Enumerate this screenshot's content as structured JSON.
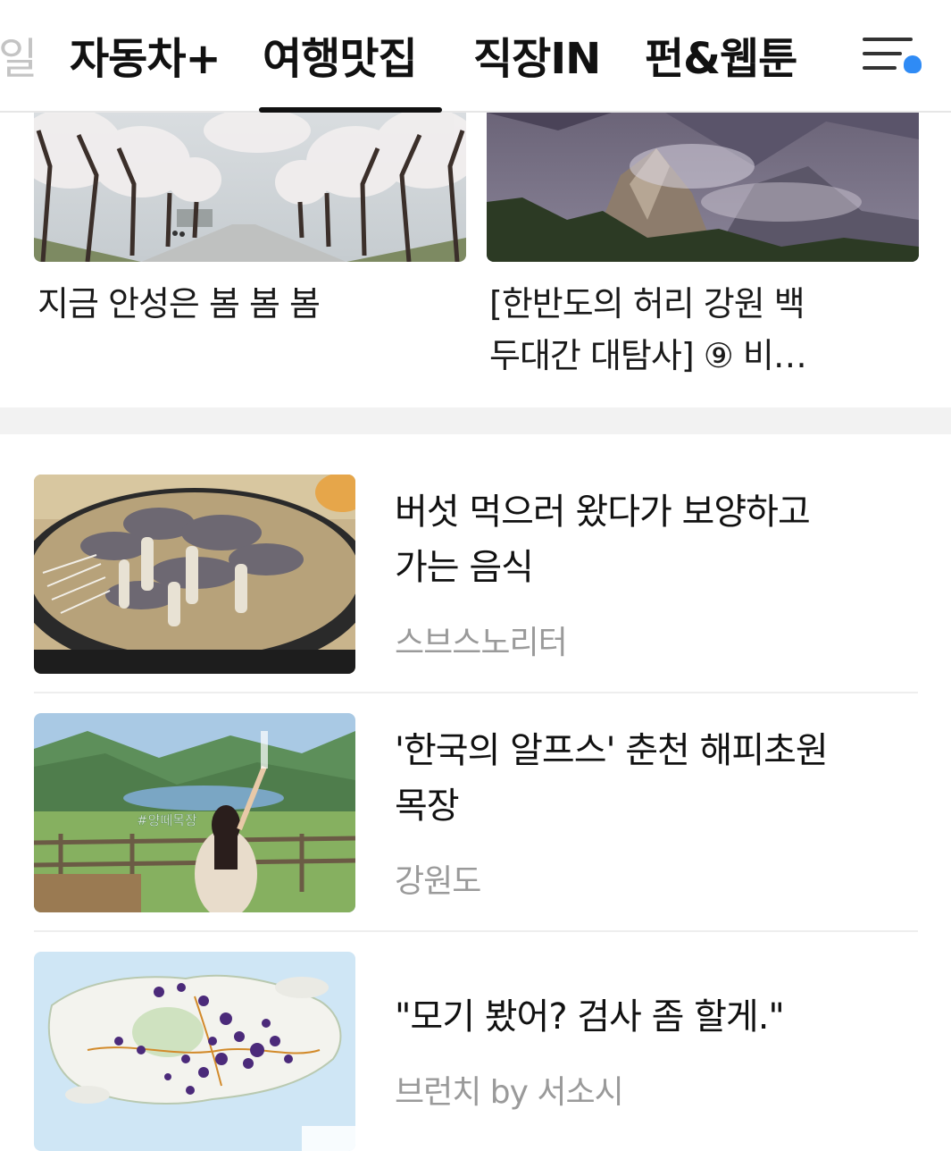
{
  "tabs": {
    "partial_left": "일",
    "items": [
      {
        "label": "자동차+"
      },
      {
        "label": "여행맛집",
        "active": true
      },
      {
        "label": "직장IN"
      },
      {
        "label": "펀&웹툰"
      }
    ],
    "menu_icon": "menu-with-notification-icon"
  },
  "cards": [
    {
      "title": "지금 안성은 봄 봄 봄",
      "image": "cherry-blossom-road"
    },
    {
      "title_line1": "[한반도의 허리 강원 백",
      "title_line2": "두대간 대탐사] ⑨ 비…",
      "image": "misty-mountain"
    }
  ],
  "list": [
    {
      "title_line1": "버섯 먹으러 왔다가 보양하고",
      "title_line2": "가는 음식",
      "source": "스브스노리터",
      "image": "mushroom-hotpot"
    },
    {
      "title_line1": "'한국의 알프스' 춘천 해피초원",
      "title_line2": "목장",
      "source": "강원도",
      "image": "mountain-lake-pasture",
      "image_caption": "#양떼목장"
    },
    {
      "title": "\"모기 봤어? 검사 좀 할게.\"",
      "source": "브런치 by 서소시",
      "image": "singapore-map"
    }
  ],
  "colors": {
    "accent": "#2f8bf5",
    "text": "#111111",
    "muted": "#9a9a9a",
    "band": "#f2f2f2"
  }
}
